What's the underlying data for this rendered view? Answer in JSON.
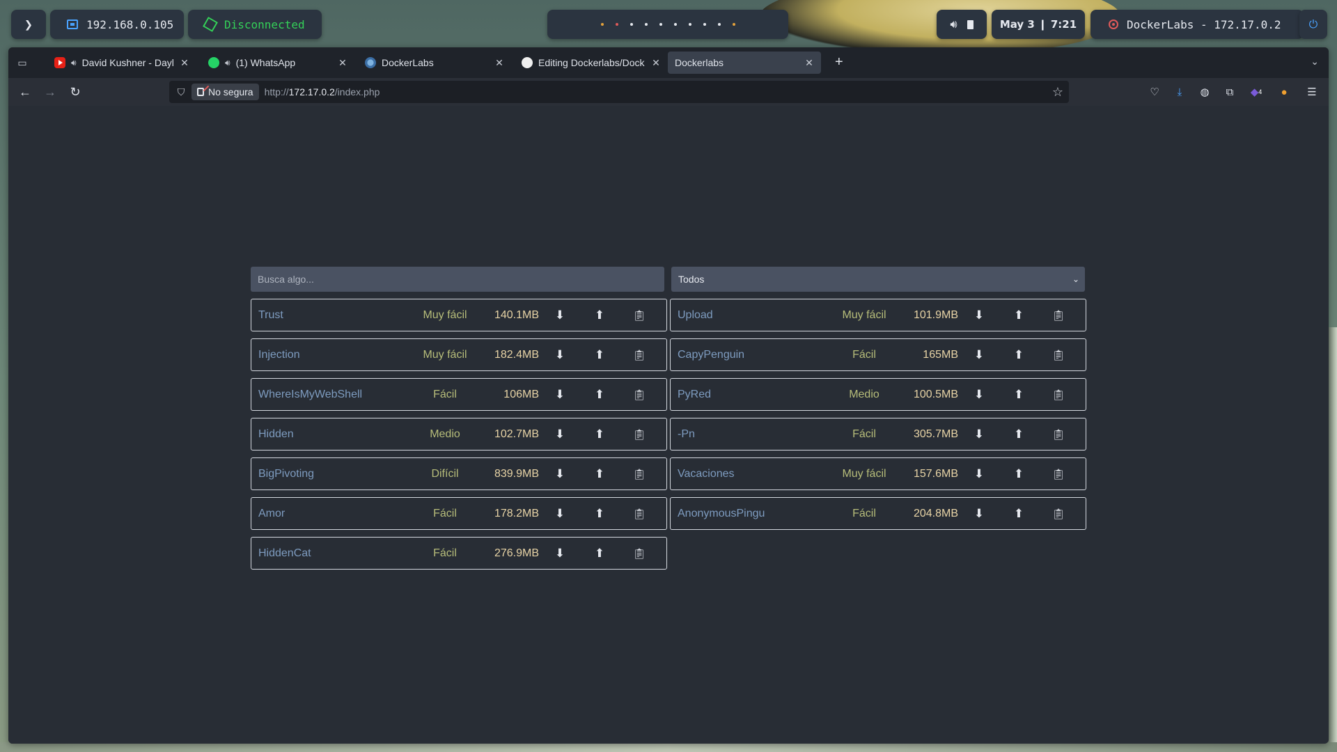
{
  "panel": {
    "ip": "192.168.0.105",
    "vpn_status": "Disconnected",
    "clock": "May 3 ❙ 7:21",
    "target": "DockerLabs - 172.17.0.2",
    "workspace_count": 10
  },
  "browser": {
    "tabs": [
      {
        "title": "David Kushner - Dayli",
        "favicon": "youtube-icon",
        "audio": true
      },
      {
        "title": "(1) WhatsApp",
        "favicon": "whatsapp-icon",
        "audio": true
      },
      {
        "title": "DockerLabs",
        "favicon": "dockerlabs-icon",
        "audio": false
      },
      {
        "title": "Editing Dockerlabs/Dock",
        "favicon": "github-icon",
        "audio": false
      },
      {
        "title": "Dockerlabs",
        "favicon": "",
        "audio": false,
        "active": true
      }
    ],
    "security_label": "No segura",
    "url_prefix": "http://",
    "url_host": "172.17.0.2",
    "url_path": "/index.php"
  },
  "page": {
    "search_placeholder": "Busca algo...",
    "filter_value": "Todos",
    "machines": [
      {
        "name": "Trust",
        "difficulty": "Muy fácil",
        "size": "140.1MB"
      },
      {
        "name": "Upload",
        "difficulty": "Muy fácil",
        "size": "101.9MB"
      },
      {
        "name": "Injection",
        "difficulty": "Muy fácil",
        "size": "182.4MB"
      },
      {
        "name": "CapyPenguin",
        "difficulty": "Fácil",
        "size": "165MB"
      },
      {
        "name": "WhereIsMyWebShell",
        "difficulty": "Fácil",
        "size": "106MB"
      },
      {
        "name": "PyRed",
        "difficulty": "Medio",
        "size": "100.5MB"
      },
      {
        "name": "Hidden",
        "difficulty": "Medio",
        "size": "102.7MB"
      },
      {
        "name": "-Pn",
        "difficulty": "Fácil",
        "size": "305.7MB"
      },
      {
        "name": "BigPivoting",
        "difficulty": "Difícil",
        "size": "839.9MB"
      },
      {
        "name": "Vacaciones",
        "difficulty": "Muy fácil",
        "size": "157.6MB"
      },
      {
        "name": "Amor",
        "difficulty": "Fácil",
        "size": "178.2MB"
      },
      {
        "name": "AnonymousPingu",
        "difficulty": "Fácil",
        "size": "204.8MB"
      },
      {
        "name": "HiddenCat",
        "difficulty": "Fácil",
        "size": "276.9MB"
      }
    ],
    "icons": {
      "download": "download-icon",
      "upload": "upload-icon",
      "clipboard": "clipboard-icon"
    }
  },
  "extensions_badge": "4"
}
